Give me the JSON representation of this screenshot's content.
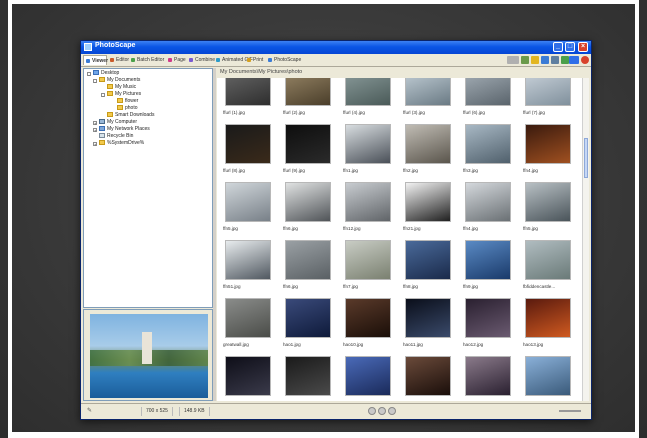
{
  "window": {
    "title": "PhotoScape"
  },
  "tabs": [
    {
      "label": "Viewer",
      "active": true,
      "color": "#3a7bd5"
    },
    {
      "label": "Editor",
      "active": false,
      "color": "#c95b2b"
    },
    {
      "label": "Batch Editor",
      "active": false,
      "color": "#4aa04a"
    },
    {
      "label": "Page",
      "active": false,
      "color": "#d03a8a"
    },
    {
      "label": "Combine",
      "active": false,
      "color": "#7a5bd0"
    },
    {
      "label": "Animated GIF",
      "active": false,
      "color": "#2b9bc9"
    },
    {
      "label": "Print",
      "active": false,
      "color": "#d4a020"
    },
    {
      "label": "PhotoScape",
      "active": false,
      "color": "#3a7bd5"
    }
  ],
  "tree": [
    {
      "label": "Desktop"
    },
    {
      "label": "My Documents"
    },
    {
      "label": "My Music"
    },
    {
      "label": "My Pictures"
    },
    {
      "label": "flower"
    },
    {
      "label": "photo"
    },
    {
      "label": "Smart Downloads"
    },
    {
      "label": "My Computer"
    },
    {
      "label": "My Network Places"
    },
    {
      "label": "Recycle Bin"
    },
    {
      "label": "%SystemDrive%"
    }
  ],
  "path": "My Documents\\My Pictures\\photo",
  "thumbnails": [
    {
      "name": "ffurl (1).jpg"
    },
    {
      "name": "ffurl (2).jpg"
    },
    {
      "name": "ffurl (4).jpg"
    },
    {
      "name": "ffurl (3).jpg"
    },
    {
      "name": "ffurl (6).jpg"
    },
    {
      "name": "ffurl (7).jpg"
    },
    {
      "name": "ffurl (8).jpg"
    },
    {
      "name": "ffurl (9).jpg"
    },
    {
      "name": "ffn1.jpg"
    },
    {
      "name": "ffn2.jpg"
    },
    {
      "name": "ffn3.jpg"
    },
    {
      "name": "ffn4.jpg"
    },
    {
      "name": "ffn5.jpg"
    },
    {
      "name": "ffn6.jpg"
    },
    {
      "name": "ffn12.jpg"
    },
    {
      "name": "ffn21.jpg"
    },
    {
      "name": "ffn4.jpg"
    },
    {
      "name": "ffn5.jpg"
    },
    {
      "name": "ffn51.jpg"
    },
    {
      "name": "ffn6.jpg"
    },
    {
      "name": "ffn7.jpg"
    },
    {
      "name": "ffn8.jpg"
    },
    {
      "name": "ffn9.jpg"
    },
    {
      "name": "fbfiddencastle..."
    },
    {
      "name": "greatwall.jpg"
    },
    {
      "name": "hao1.jpg"
    },
    {
      "name": "hao10.jpg"
    },
    {
      "name": "hao11.jpg"
    },
    {
      "name": "hao12.jpg"
    },
    {
      "name": "hao13.jpg"
    },
    {
      "name": ""
    },
    {
      "name": ""
    },
    {
      "name": ""
    },
    {
      "name": ""
    },
    {
      "name": ""
    },
    {
      "name": ""
    }
  ],
  "status": {
    "dimensions": "700 x 525",
    "size": "148.9 KB"
  }
}
